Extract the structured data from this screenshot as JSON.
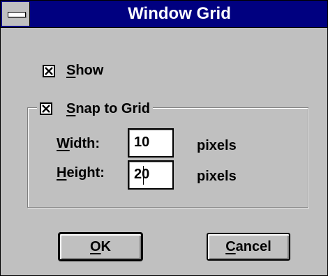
{
  "window": {
    "title": "Window Grid"
  },
  "options": {
    "show": {
      "mnemonic": "S",
      "rest": "how",
      "checked": true
    },
    "snap_to_grid": {
      "mnemonic": "S",
      "rest": "nap to Grid",
      "checked": true
    }
  },
  "grid": {
    "width": {
      "label_mnemonic": "W",
      "label_rest": "idth:",
      "value": "10",
      "unit": "pixels"
    },
    "height": {
      "label_mnemonic": "H",
      "label_rest": "eight:",
      "value": "20",
      "unit": "pixels"
    }
  },
  "buttons": {
    "ok": {
      "mnemonic": "O",
      "rest": "K"
    },
    "cancel": {
      "mnemonic": "C",
      "rest": "ancel"
    }
  },
  "colors": {
    "titlebar": "#000080",
    "face": "#c0c0c0",
    "shadow": "#808080",
    "highlight": "#ffffff"
  },
  "icons": {
    "system_menu": "system-menu-icon",
    "check": "check-x-icon"
  }
}
